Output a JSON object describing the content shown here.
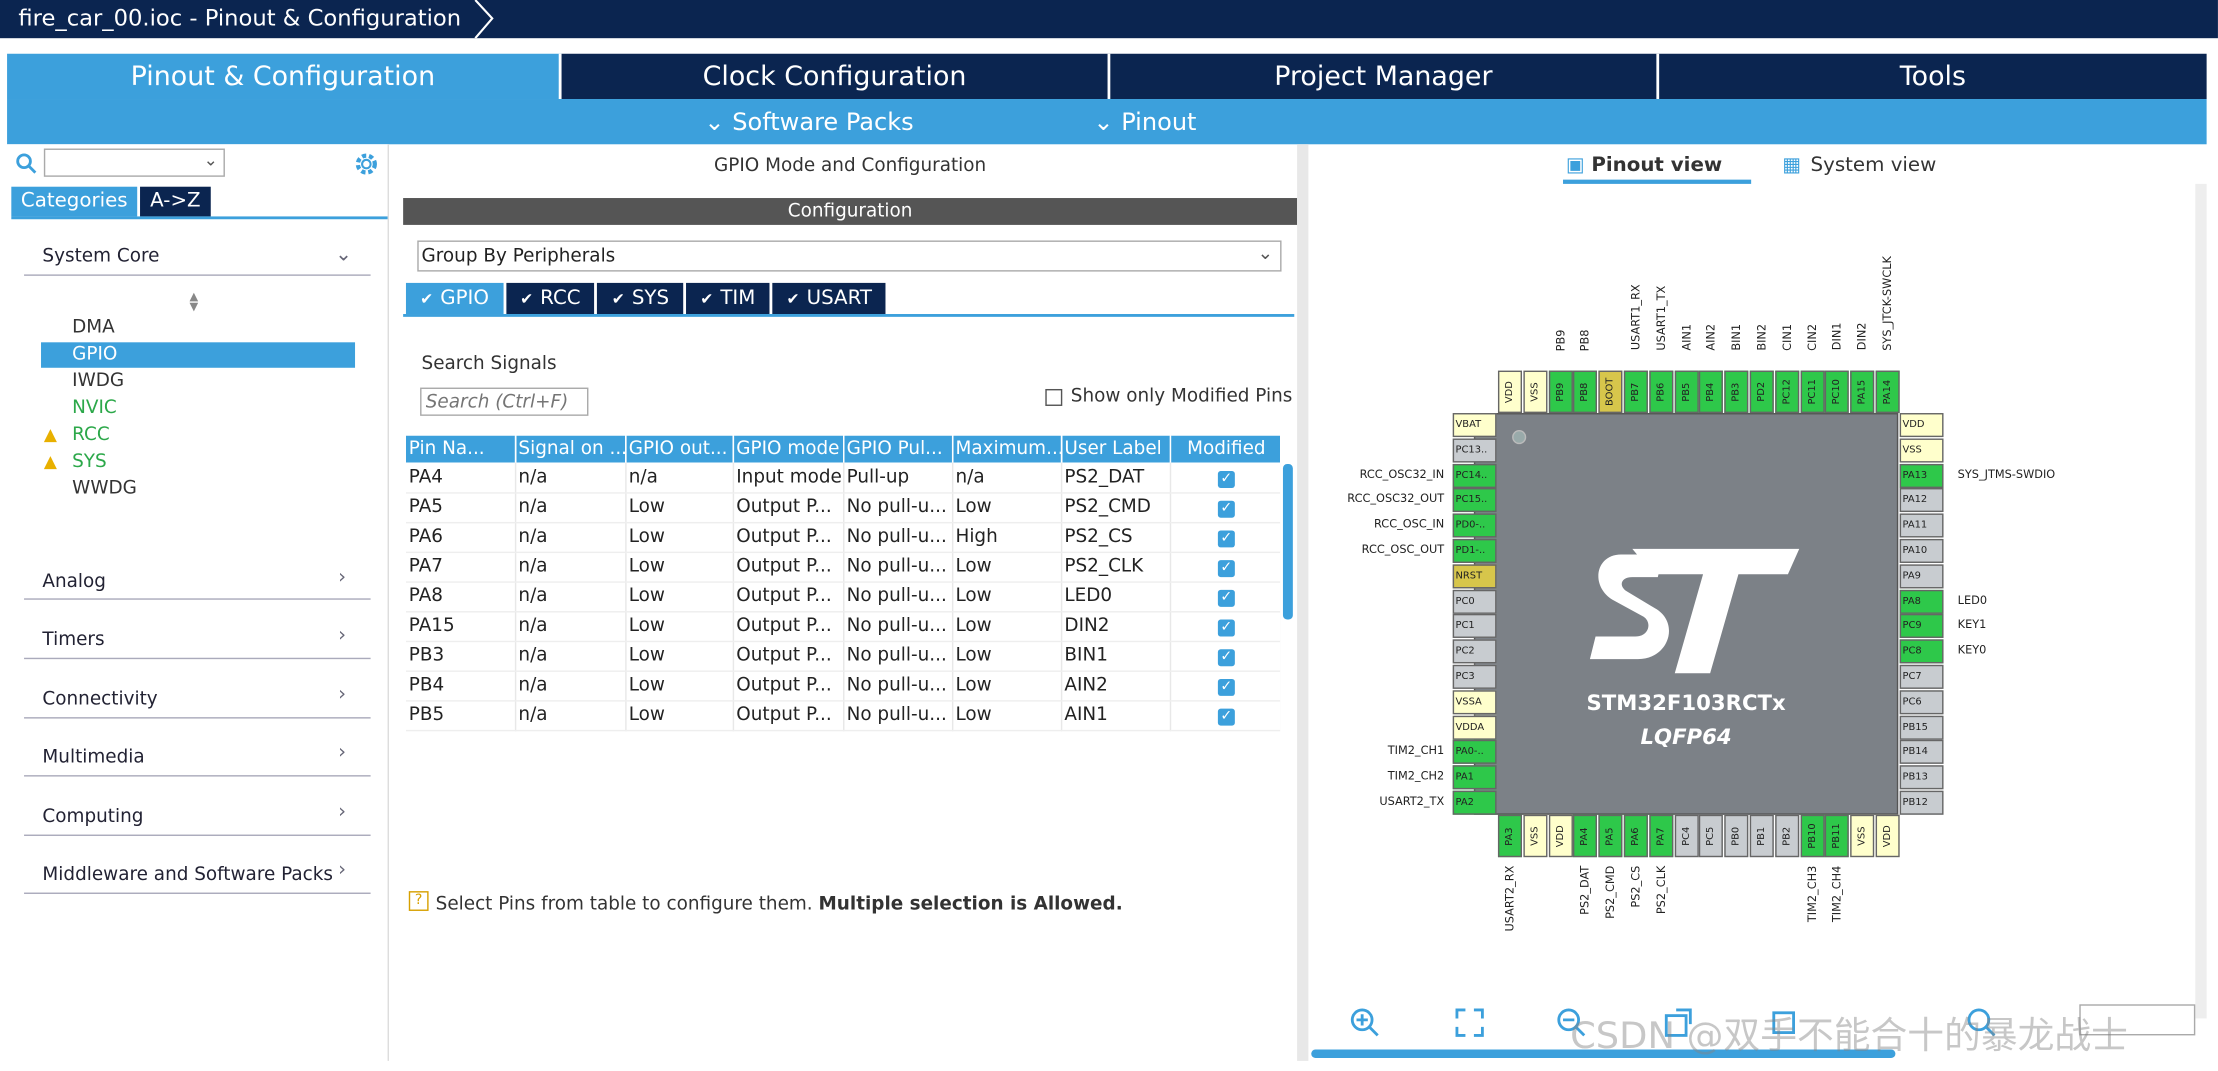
{
  "title": "fire_car_00.ioc - Pinout & Configuration",
  "tabs": [
    "Pinout & Configuration",
    "Clock Configuration",
    "Project Manager",
    "Tools"
  ],
  "subtabs": [
    "Software Packs",
    "Pinout"
  ],
  "left": {
    "cat_tab": "Categories",
    "az_tab": "A->Z",
    "groups": [
      "System Core",
      "Analog",
      "Timers",
      "Connectivity",
      "Multimedia",
      "Computing",
      "Middleware and Software Packs"
    ],
    "core_items": [
      "DMA",
      "GPIO",
      "IWDG",
      "NVIC",
      "RCC",
      "SYS",
      "WWDG"
    ]
  },
  "mid": {
    "header": "GPIO Mode and Configuration",
    "config": "Configuration",
    "groupby": "Group By Peripherals",
    "ptabs": [
      "GPIO",
      "RCC",
      "SYS",
      "TIM",
      "USART"
    ],
    "search_label": "Search Signals",
    "search_ph": "Search (Ctrl+F)",
    "show_mod": "Show only Modified Pins",
    "cols": [
      "Pin Na...",
      "Signal on ...",
      "GPIO out...",
      "GPIO mode",
      "GPIO Pul...",
      "Maximum...",
      "User Label",
      "Modified"
    ],
    "rows": [
      [
        "PA4",
        "n/a",
        "n/a",
        "Input mode",
        "Pull-up",
        "n/a",
        "PS2_DAT"
      ],
      [
        "PA5",
        "n/a",
        "Low",
        "Output P...",
        "No pull-u...",
        "Low",
        "PS2_CMD"
      ],
      [
        "PA6",
        "n/a",
        "Low",
        "Output P...",
        "No pull-u...",
        "High",
        "PS2_CS"
      ],
      [
        "PA7",
        "n/a",
        "Low",
        "Output P...",
        "No pull-u...",
        "Low",
        "PS2_CLK"
      ],
      [
        "PA8",
        "n/a",
        "Low",
        "Output P...",
        "No pull-u...",
        "Low",
        "LED0"
      ],
      [
        "PA15",
        "n/a",
        "Low",
        "Output P...",
        "No pull-u...",
        "Low",
        "DIN2"
      ],
      [
        "PB3",
        "n/a",
        "Low",
        "Output P...",
        "No pull-u...",
        "Low",
        "BIN1"
      ],
      [
        "PB4",
        "n/a",
        "Low",
        "Output P...",
        "No pull-u...",
        "Low",
        "AIN2"
      ],
      [
        "PB5",
        "n/a",
        "Low",
        "Output P...",
        "No pull-u...",
        "Low",
        "AIN1"
      ]
    ],
    "hint": "Select Pins from table to configure them.",
    "hint_bold": "Multiple selection is Allowed."
  },
  "right": {
    "pinout_view": "Pinout view",
    "system_view": "System view",
    "chip": "STM32F103RCTx",
    "pkg": "LQFP64",
    "watermark": "CSDN @双手不能合十的暴龙战士"
  },
  "chip": {
    "top": [
      "VDD",
      "VSS",
      "PB9",
      "PB8",
      "BOOT",
      "PB7",
      "PB6",
      "PB5",
      "PB4",
      "PB3",
      "PD2",
      "PC12",
      "PC11",
      "PC10",
      "PA15",
      "PA14"
    ],
    "top_color": [
      "y",
      "y",
      "g",
      "g",
      "o",
      "g",
      "g",
      "g",
      "g",
      "g",
      "g",
      "g",
      "g",
      "g",
      "g",
      "g"
    ],
    "top_lbl": [
      "",
      "",
      "PB9",
      "PB8",
      "",
      "USART1_RX",
      "USART1_TX",
      "AIN1",
      "AIN2",
      "BIN1",
      "BIN2",
      "CIN1",
      "CIN2",
      "DIN1",
      "DIN2",
      "SYS_JTCK-SWCLK"
    ],
    "left": [
      "VBAT",
      "PC13..",
      "PC14..",
      "PC15..",
      "PD0-..",
      "PD1-..",
      "NRST",
      "PC0",
      "PC1",
      "PC2",
      "PC3",
      "VSSA",
      "VDDA",
      "PA0-..",
      "PA1",
      "PA2"
    ],
    "left_color": [
      "y",
      "gr",
      "g",
      "g",
      "g",
      "g",
      "o",
      "gr",
      "gr",
      "gr",
      "gr",
      "y",
      "y",
      "g",
      "g",
      "g"
    ],
    "left_lbl": [
      "",
      "",
      "RCC_OSC32_IN",
      "RCC_OSC32_OUT",
      "RCC_OSC_IN",
      "RCC_OSC_OUT",
      "",
      "",
      "",
      "",
      "",
      "",
      "",
      "TIM2_CH1",
      "TIM2_CH2",
      "USART2_TX"
    ],
    "right": [
      "VDD",
      "VSS",
      "PA13",
      "PA12",
      "PA11",
      "PA10",
      "PA9",
      "PA8",
      "PC9",
      "PC8",
      "PC7",
      "PC6",
      "PB15",
      "PB14",
      "PB13",
      "PB12"
    ],
    "right_color": [
      "y",
      "y",
      "g",
      "gr",
      "gr",
      "gr",
      "gr",
      "g",
      "g",
      "g",
      "gr",
      "gr",
      "gr",
      "gr",
      "gr",
      "gr"
    ],
    "right_lbl": [
      "",
      "",
      "SYS_JTMS-SWDIO",
      "",
      "",
      "",
      "",
      "LED0",
      "KEY1",
      "KEY0",
      "",
      "",
      "",
      "",
      "",
      ""
    ],
    "bottom": [
      "PA3",
      "VSS",
      "VDD",
      "PA4",
      "PA5",
      "PA6",
      "PA7",
      "PC4",
      "PC5",
      "PB0",
      "PB1",
      "PB2",
      "PB10",
      "PB11",
      "VSS",
      "VDD"
    ],
    "bottom_color": [
      "g",
      "y",
      "y",
      "g",
      "g",
      "g",
      "g",
      "gr",
      "gr",
      "gr",
      "gr",
      "gr",
      "g",
      "g",
      "y",
      "y"
    ],
    "bottom_lbl": [
      "USART2_RX",
      "",
      "",
      "PS2_DAT",
      "PS2_CMD",
      "PS2_CS",
      "PS2_CLK",
      "",
      "",
      "",
      "",
      "",
      "TIM2_CH3",
      "TIM2_CH4",
      "",
      ""
    ]
  }
}
